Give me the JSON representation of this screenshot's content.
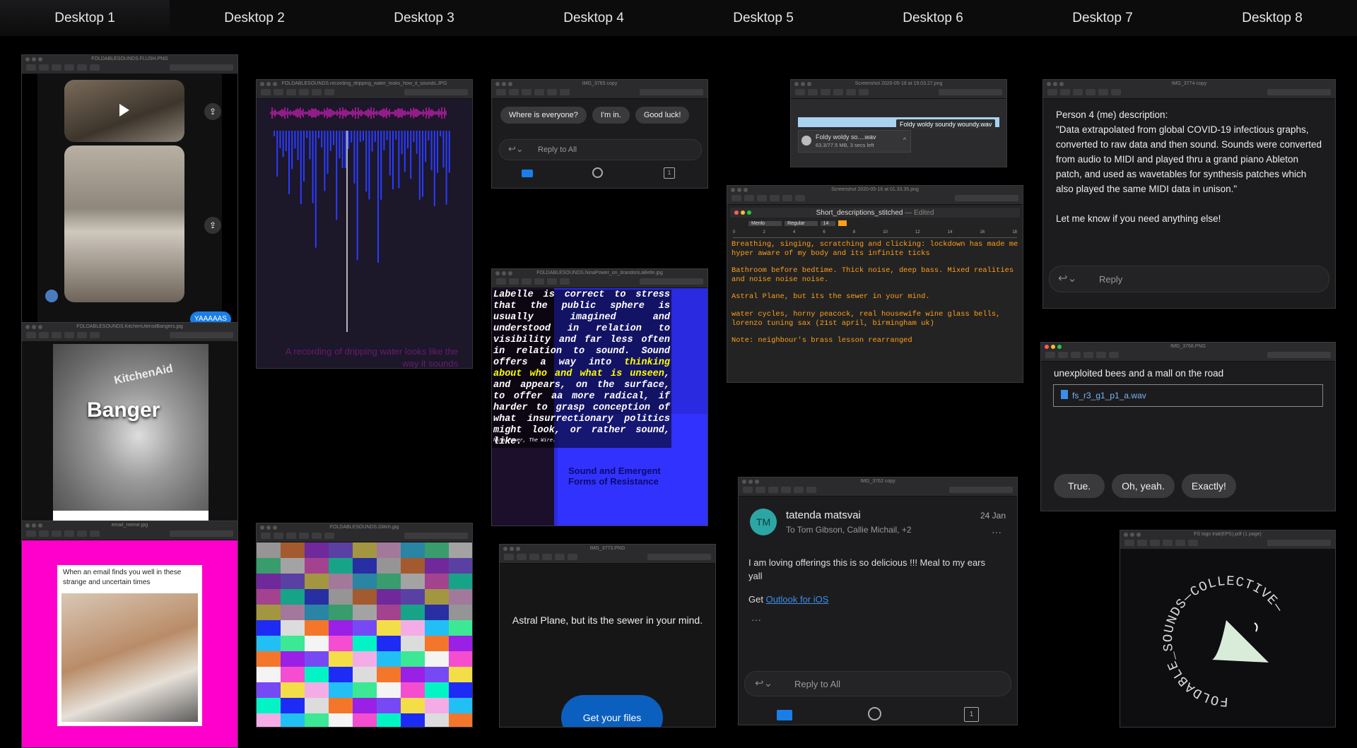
{
  "desktops": [
    "Desktop 1",
    "Desktop 2",
    "Desktop 3",
    "Desktop 4",
    "Desktop 5",
    "Desktop 6",
    "Desktop 7",
    "Desktop 8"
  ],
  "windows": {
    "flush": {
      "title": "FOLDABLESOUNDS.FLUSH.PNG",
      "chat_bubble": "YAAAAAS"
    },
    "water": {
      "title": "FOLDABLESOUNDS.recording_dripping_water_looks_how_it_sounds.JPG",
      "caption": "A recording of dripping water looks like the way it sounds"
    },
    "kitchen": {
      "title": "FOLDABLESOUNDS.KitchenUtensilBangers.jpg",
      "brand": "KitchenAid",
      "banger": "Banger"
    },
    "meme": {
      "title": "email_meme.jpg",
      "caption": "When an email finds you well in these strange and uncertain times"
    },
    "glitch": {
      "title": "FOLDABLESOUNDS.Glitch.jpg"
    },
    "mail1": {
      "title": "IMG_3765 copy",
      "replies": [
        "Where is everyone?",
        "I'm in.",
        "Good luck!"
      ],
      "reply_all": "Reply to All"
    },
    "power": {
      "title": "FOLDABLESOUNDS.NinaPower_on_brandonLaBelle.jpg",
      "quote": "Labelle is correct to stress that the public sphere is usually imagined and understood in relation to visibility and far less often in relation to sound. Sound offers a way into ",
      "highlight": "thinking about who and what is unseen",
      "quote_end": ", and appears, on the surface, to offer aa more radical, if harder to grasp conception of what insurrectionary politics might look, or rather sound, like.",
      "cite": "Nina Power, The Wire.",
      "book_title": "Sound and Emergent Forms of Resistance"
    },
    "astral": {
      "title": "IMG_3773.PNG",
      "text": "Astral Plane, but its the sewer in your mind.",
      "button": "Get your files"
    },
    "download": {
      "title": "Screenshot 2020-05-18 at 19.03.27.png",
      "tooltip": "Foldy woldy soundy woundy.wav",
      "file": "Foldy woldy so....wav",
      "size": "63.3/77.5 MB, 3 secs left"
    },
    "textedit": {
      "title": "Screenshot 2020-05-16 at 01.33.35.png",
      "doc_title": "Short_descriptions_stitched",
      "edited": "— Edited",
      "font": "Menlo",
      "weight": "Regular",
      "size": "14",
      "ruler": [
        "0",
        "2",
        "4",
        "6",
        "8",
        "10",
        "12",
        "14",
        "16",
        "18"
      ],
      "lines": [
        "Breathing, singing, scratching and clicking: lockdown has made me hyper aware of my body and its infinite ticks",
        "",
        "Bathroom before bedtime. Thick noise, deep bass. Mixed realities and noise noise noise.",
        "",
        "Astral Plane, but its the sewer in your mind.",
        "",
        "water cycles, horny peacock, real housewife wine glass bells, lorenzo tuning sax (21st april, birmingham uk)",
        "",
        "Note: neighbour's brass lesson rearranged"
      ]
    },
    "outlook": {
      "title": "IMG_3762 copy",
      "avatar": "TM",
      "sender": "tatenda matsvai",
      "date": "24 Jan",
      "to": "To Tom Gibson, Callie Michail, +2",
      "body": "I am loving offerings this is so delicious !!! Meal to my ears yall",
      "get": "Get ",
      "link": "Outlook for iOS",
      "reply_all": "Reply to All"
    },
    "person4": {
      "title": "IMG_3774 copy",
      "paragraphs": [
        "Person 4 (me) description:",
        "\"Data extrapolated from global COVID-19 infectious graphs, converted to raw data and then sound. Sounds were converted from audio to MIDI and played thru a grand piano Ableton patch, and used as wavetables for synthesis patches which also played the same MIDI data in unison.\"",
        "Let me know if you need anything else!"
      ],
      "reply": "Reply"
    },
    "bees": {
      "title": "IMG_3768.PNG",
      "text": "unexploited bees and a mall on the road",
      "file": "fs_r3_g1_p1_a.wav",
      "replies": [
        "True.",
        "Oh, yeah.",
        "Exactly!"
      ]
    },
    "logo": {
      "title": "FS logo trial(EPS).pdf (1 page)",
      "ring_text": "FOLDABLE_SOUNDS—COLLECTIVE—"
    }
  },
  "colors": {
    "accent_blue": "#1a6fd0",
    "magenta": "#ff00cc",
    "highlight_yellow": "#ffff00",
    "editor_orange": "#ff9f1c",
    "teal": "#2ca6a4"
  }
}
